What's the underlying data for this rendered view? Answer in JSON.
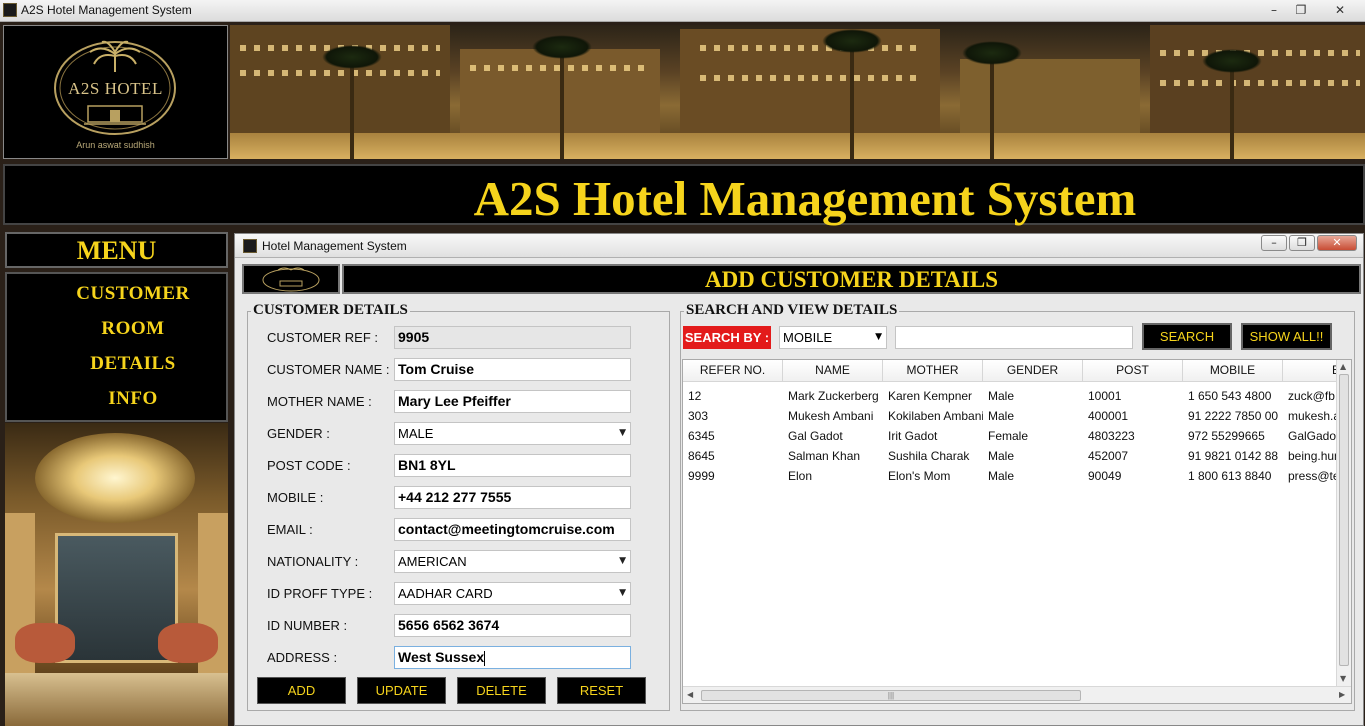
{
  "window": {
    "title": "A2S Hotel Management System",
    "controls": [
      "–",
      "❐",
      "✕"
    ]
  },
  "logo": {
    "name": "A2S HOTEL",
    "subtitle": "Arun aswat sudhish"
  },
  "header": {
    "title": "A2S Hotel Management System"
  },
  "menu": {
    "title": "MENU",
    "items": [
      "CUSTOMER",
      "ROOM",
      "DETAILS",
      "INFO"
    ]
  },
  "inner_window": {
    "title": "Hotel Management System",
    "controls": [
      "–",
      "❐",
      "✕"
    ]
  },
  "form": {
    "heading": "ADD CUSTOMER DETAILS",
    "section_title": "CUSTOMER DETAILS",
    "fields": [
      {
        "label": "CUSTOMER REF :",
        "value": "9905"
      },
      {
        "label": "CUSTOMER NAME :",
        "value": "Tom Cruise"
      },
      {
        "label": "MOTHER NAME :",
        "value": "Mary Lee Pfeiffer"
      },
      {
        "label": "GENDER :",
        "value": "MALE"
      },
      {
        "label": "POST CODE :",
        "value": "BN1 8YL"
      },
      {
        "label": "MOBILE :",
        "value": "+44 212 277 7555"
      },
      {
        "label": "EMAIL :",
        "value": "contact@meetingtomcruise.com"
      },
      {
        "label": "NATIONALITY :",
        "value": "AMERICAN"
      },
      {
        "label": "ID PROFF TYPE :",
        "value": "AADHAR CARD"
      },
      {
        "label": "ID NUMBER :",
        "value": "5656 6562 3674"
      },
      {
        "label": "ADDRESS :",
        "value": "West Sussex"
      }
    ],
    "buttons": [
      "ADD",
      "UPDATE",
      "DELETE",
      "RESET"
    ]
  },
  "search": {
    "section_title": "SEARCH AND VIEW DETAILS",
    "search_by_label": "SEARCH BY :",
    "search_by_value": "MOBILE",
    "query": "",
    "search_button": "SEARCH",
    "show_all_button": "SHOW ALL!!"
  },
  "table": {
    "columns": [
      "REFER NO.",
      "NAME",
      "MOTHER",
      "GENDER",
      "POST",
      "MOBILE",
      "EMAIL"
    ],
    "rows": [
      [
        "12",
        "Mark Zuckerberg",
        "Karen Kempner",
        "Male",
        "10001",
        "1 650 543 4800",
        "zuck@fb.com"
      ],
      [
        "303",
        "Mukesh Ambani",
        "Kokilaben Ambani",
        "Male",
        "400001",
        "91 2222 7850 00",
        "mukesh.ambani"
      ],
      [
        "6345",
        "Gal Gadot",
        "Irit Gadot",
        "Female",
        "4803223",
        "972 55299665",
        "GalGadot"
      ],
      [
        "8645",
        "Salman Khan",
        "Sushila Charak",
        "Male",
        "452007",
        "91 9821 0142 88",
        "being.human"
      ],
      [
        "9999",
        "Elon",
        "Elon's Mom",
        "Male",
        "90049",
        "1 800 613 8840",
        "press@tesla.com"
      ]
    ]
  }
}
